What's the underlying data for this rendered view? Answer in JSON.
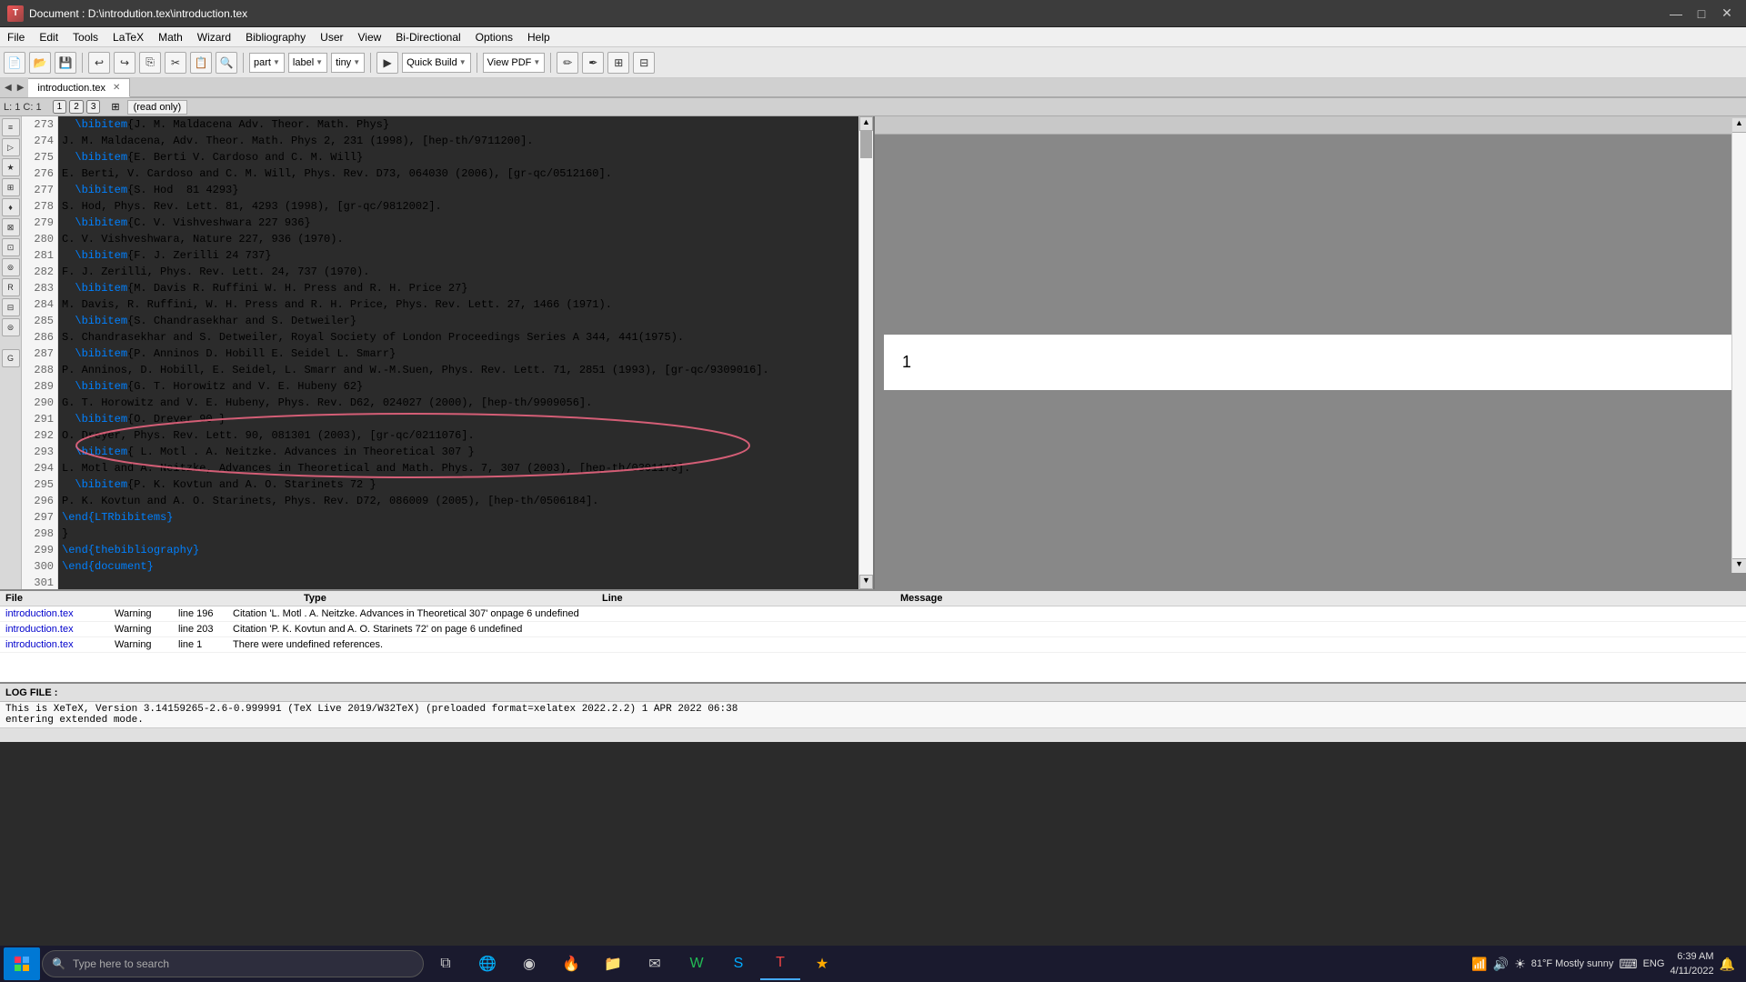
{
  "titlebar": {
    "icon": "T",
    "title": "Document : D:\\introdution.tex\\introduction.tex",
    "minimize": "—",
    "maximize": "□",
    "close": "✕"
  },
  "menubar": {
    "items": [
      "File",
      "Edit",
      "Tools",
      "LaTeX",
      "Math",
      "Wizard",
      "Bibliography",
      "User",
      "View",
      "Bi-Directional",
      "Options",
      "Help"
    ]
  },
  "toolbar": {
    "part_value": "part",
    "label_value": "label",
    "tiny_value": "tiny",
    "quick_build_label": "Quick Build",
    "view_pdf_label": "View PDF"
  },
  "tabs": {
    "active": "introduction.tex"
  },
  "statusbar": {
    "position": "L: 1 C: 1",
    "page": "1",
    "readonly": "(read only)"
  },
  "code_lines": [
    {
      "num": "273",
      "content": "  \\bibitem{J. M. Maldacena Adv. Theor. Math. Phys}",
      "has_bibitem": true
    },
    {
      "num": "274",
      "content": "J. M. Maldacena, Adv. Theor. Math. Phys 2, 231 (1998), [hep-th/9711200].",
      "has_bibitem": false
    },
    {
      "num": "275",
      "content": "  \\bibitem{E. Berti V. Cardoso and C. M. Will}",
      "has_bibitem": true
    },
    {
      "num": "276",
      "content": "E. Berti, V. Cardoso and C. M. Will, Phys. Rev. D73, 064030 (2006), [gr-qc/0512160].",
      "has_bibitem": false
    },
    {
      "num": "277",
      "content": "  \\bibitem{S. Hod  81 4293}",
      "has_bibitem": true
    },
    {
      "num": "278",
      "content": "S. Hod, Phys. Rev. Lett. 81, 4293 (1998), [gr-qc/9812002].",
      "has_bibitem": false
    },
    {
      "num": "279",
      "content": "  \\bibitem{C. V. Vishveshwara 227 936}",
      "has_bibitem": true
    },
    {
      "num": "280",
      "content": "C. V. Vishveshwara, Nature 227, 936 (1970).",
      "has_bibitem": false
    },
    {
      "num": "281",
      "content": "  \\bibitem{F. J. Zerilli 24 737}",
      "has_bibitem": true
    },
    {
      "num": "282",
      "content": "F. J. Zerilli, Phys. Rev. Lett. 24, 737 (1970).",
      "has_bibitem": false
    },
    {
      "num": "283",
      "content": "  \\bibitem{M. Davis R. Ruffini W. H. Press and R. H. Price 27}",
      "has_bibitem": true
    },
    {
      "num": "284",
      "content": "M. Davis, R. Ruffini, W. H. Press and R. H. Price, Phys. Rev. Lett. 27, 1466 (1971).",
      "has_bibitem": false
    },
    {
      "num": "285",
      "content": "  \\bibitem{S. Chandrasekhar and S. Detweiler}",
      "has_bibitem": true
    },
    {
      "num": "286",
      "content": "S. Chandrasekhar and S. Detweiler, Royal Society of London Proceedings Series A 344, 441(1975).",
      "has_bibitem": false
    },
    {
      "num": "287",
      "content": "  \\bibitem{P. Anninos D. Hobill E. Seidel L. Smarr}",
      "has_bibitem": true
    },
    {
      "num": "288",
      "content": "P. Anninos, D. Hobill, E. Seidel, L. Smarr and W.-M.Suen, Phys. Rev. Lett. 71, 2851 (1993), [gr-qc/9309016].",
      "has_bibitem": false
    },
    {
      "num": "289",
      "content": "  \\bibitem{G. T. Horowitz and V. E. Hubeny 62}",
      "has_bibitem": true
    },
    {
      "num": "290",
      "content": "G. T. Horowitz and V. E. Hubeny, Phys. Rev. D62, 024027 (2000), [hep-th/9909056].",
      "has_bibitem": false
    },
    {
      "num": "291",
      "content": "  \\bibitem{O. Dreyer 90 }",
      "has_bibitem": true
    },
    {
      "num": "292",
      "content": "O. Dreyer, Phys. Rev. Lett. 90, 081301 (2003), [gr-qc/0211076].",
      "has_bibitem": false
    },
    {
      "num": "293",
      "content": "  \\bibitem{ L. Motl . A. Neitzke. Advances in Theoretical 307 }",
      "has_bibitem": true
    },
    {
      "num": "294",
      "content": "L. Motl and A. Neitzke, Advances in Theoretical and Math. Phys. 7, 307 (2003), [hep-th/0301173].",
      "has_bibitem": false
    },
    {
      "num": "295",
      "content": "  \\bibitem{P. K. Kovtun and A. O. Starinets 72 }",
      "has_bibitem": true
    },
    {
      "num": "296",
      "content": "P. K. Kovtun and A. O. Starinets, Phys. Rev. D72, 086009 (2005), [hep-th/0506184].",
      "has_bibitem": false
    },
    {
      "num": "297",
      "content": "\\end{LTRbibitems}",
      "has_bibitem": false,
      "is_end": true
    },
    {
      "num": "298",
      "content": "}",
      "has_bibitem": false
    },
    {
      "num": "299",
      "content": "\\end{thebibliography}",
      "has_bibitem": false,
      "is_end": true
    },
    {
      "num": "300",
      "content": "\\end{document}",
      "has_bibitem": false,
      "is_end": true
    },
    {
      "num": "301",
      "content": "",
      "has_bibitem": false
    }
  ],
  "messages": {
    "columns": [
      "File",
      "Type",
      "Line",
      "Message"
    ],
    "rows": [
      {
        "file": "introduction.tex",
        "type": "Warning",
        "line": "line 196",
        "text": "Citation 'L. Motl . A. Neitzke. Advances in Theoretical 307' onpage 6 undefined"
      },
      {
        "file": "introduction.tex",
        "type": "Warning",
        "line": "line 203",
        "text": "Citation 'P. K. Kovtun and A. O. Starinets 72' on page 6 undefined"
      },
      {
        "file": "introduction.tex",
        "type": "Warning",
        "line": "line 1",
        "text": "There were undefined references."
      }
    ]
  },
  "log": {
    "header": "LOG FILE :",
    "line1": "This is XeTeX, Version 3.14159265-2.6-0.999991 (TeX Live 2019/W32TeX) (preloaded format=xelatex 2022.2.2) 1 APR 2022 06:38",
    "line2": "entering extended mode."
  },
  "preview": {
    "page_number": "1"
  },
  "taskbar": {
    "search_placeholder": "Type here to search",
    "time": "6:39 AM",
    "date": "4/11/2022",
    "temperature": "81°F Mostly sunny",
    "language": "ENG",
    "apps": [
      {
        "name": "task-view",
        "symbol": "⧉"
      },
      {
        "name": "browser-edge",
        "symbol": "🌐"
      },
      {
        "name": "browser-chrome",
        "symbol": "◉"
      },
      {
        "name": "browser-firefox",
        "symbol": "🦊"
      },
      {
        "name": "file-explorer",
        "symbol": "📁"
      },
      {
        "name": "mail",
        "symbol": "✉"
      },
      {
        "name": "word",
        "symbol": "W"
      },
      {
        "name": "skype",
        "symbol": "S"
      },
      {
        "name": "texmaker",
        "symbol": "T"
      },
      {
        "name": "app-yellow",
        "symbol": "★"
      }
    ]
  }
}
